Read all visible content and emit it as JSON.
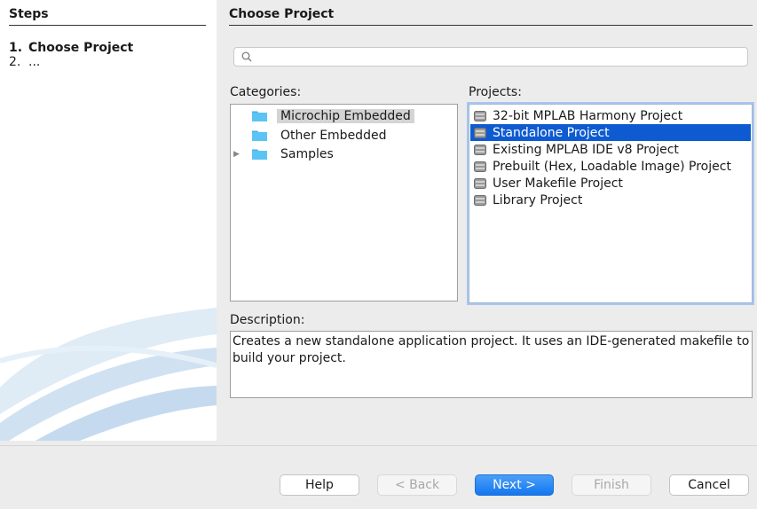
{
  "steps": {
    "title": "Steps",
    "items": [
      {
        "num": "1.",
        "label": "Choose Project"
      },
      {
        "num": "2.",
        "label": "..."
      }
    ]
  },
  "panel": {
    "title": "Choose Project",
    "search": {
      "value": "",
      "placeholder": ""
    }
  },
  "categories": {
    "label": "Categories:",
    "items": [
      {
        "label": "Microchip Embedded",
        "selected": true,
        "expandable": false
      },
      {
        "label": "Other Embedded",
        "selected": false,
        "expandable": false
      },
      {
        "label": "Samples",
        "selected": false,
        "expandable": true
      }
    ]
  },
  "projects": {
    "label": "Projects:",
    "items": [
      {
        "label": "32-bit MPLAB Harmony Project",
        "selected": false
      },
      {
        "label": "Standalone Project",
        "selected": true
      },
      {
        "label": "Existing MPLAB IDE v8 Project",
        "selected": false
      },
      {
        "label": "Prebuilt (Hex, Loadable Image) Project",
        "selected": false
      },
      {
        "label": "User Makefile Project",
        "selected": false
      },
      {
        "label": "Library Project",
        "selected": false
      }
    ]
  },
  "description": {
    "label": "Description:",
    "text": "Creates a new standalone application project. It uses an IDE-generated makefile to build your project."
  },
  "buttons": {
    "help": "Help",
    "back": "< Back",
    "next": "Next >",
    "finish": "Finish",
    "cancel": "Cancel"
  },
  "colors": {
    "selection": "#0e5bd1",
    "folder": "#3fb3f0",
    "default_button": "#1577f0"
  },
  "icons": {
    "search": "search-icon",
    "folder": "folder-icon",
    "project": "project-chip-icon",
    "expander": "disclosure-triangle-icon"
  }
}
